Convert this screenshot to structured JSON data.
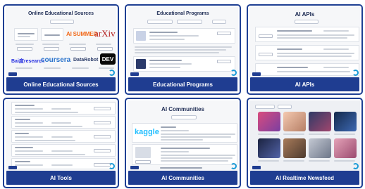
{
  "cards": [
    {
      "caption": "Online Educational Sources",
      "inner_title": "Online Educational Sources",
      "logos": {
        "ai_summer": "AI SUMMER",
        "arxiv": "arXiv",
        "baidu": "Bai度research",
        "coursera": "coursera",
        "datarobot": "DataRobot",
        "dev": "DEV"
      }
    },
    {
      "caption": "Educational Programs",
      "inner_title": "Educational Programs"
    },
    {
      "caption": "AI APIs",
      "inner_title": "AI APIs"
    },
    {
      "caption": "AI Tools"
    },
    {
      "caption": "AI Communities",
      "inner_title": "AI Communities",
      "logos": {
        "kaggle": "kaggle"
      }
    },
    {
      "caption": "AI Realtime Newsfeed"
    }
  ],
  "colors": {
    "border": "#1e3f93",
    "caption_bg": "#1f3d91",
    "ring": "#1b9bd7"
  }
}
